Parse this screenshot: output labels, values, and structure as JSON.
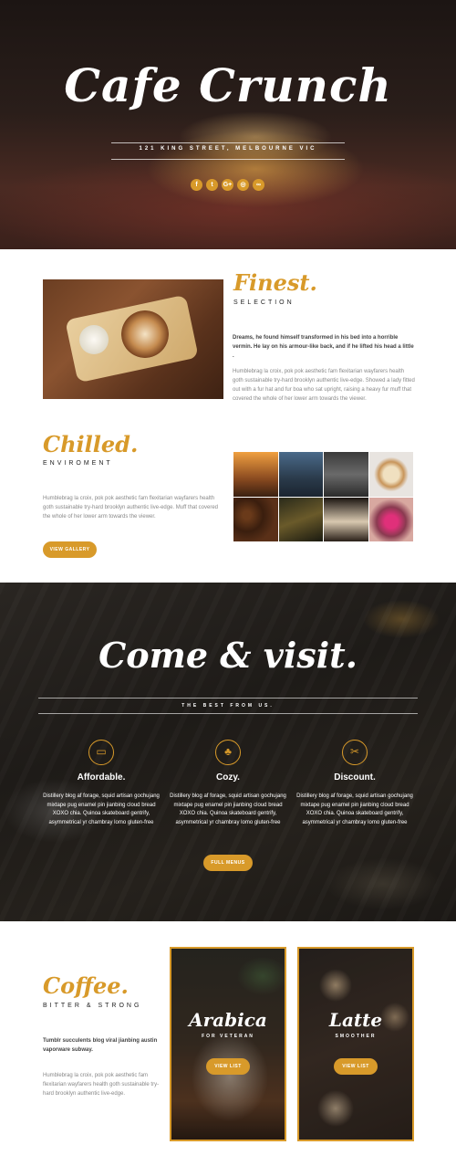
{
  "colors": {
    "accent": "#d89a2a",
    "dark_bg": "#1e1b18"
  },
  "hero": {
    "title": "Cafe Crunch",
    "address": "121 KING STREET, MELBOURNE VIC",
    "socials": [
      {
        "icon": "facebook-icon",
        "glyph": "f"
      },
      {
        "icon": "twitter-icon",
        "glyph": "t"
      },
      {
        "icon": "google-plus-icon",
        "glyph": "G+"
      },
      {
        "icon": "instagram-icon",
        "glyph": "◎"
      },
      {
        "icon": "tripadvisor-icon",
        "glyph": "∞"
      }
    ]
  },
  "finest": {
    "title": "Finest.",
    "subtitle": "SELECTION",
    "lead": "Dreams, he found himself transformed in his bed into a horrible vermin. He lay on his armour-like back, and if he lifted his head a little .",
    "body": "Humblebrag la croix, pok pok aesthetic fam flexitarian wayfarers health goth sustainable try-hard brooklyn authentic live-edge. Showed a lady fitted out with a fur hat and fur boa who sat upright, raising a heavy fur muff that covered the whole of her lower arm towards the viewer."
  },
  "chilled": {
    "title": "Chilled.",
    "subtitle": "ENVIROMENT",
    "body": "Humblebrag la croix, pok pok aesthetic fam flexitarian wayfarers health goth sustainable try-hard brooklyn authentic live-edge. Muff that covered the whole of her lower arm towards the viewer.",
    "button": "VIEW GALLERY"
  },
  "visit": {
    "title": "Come & visit.",
    "subtitle": "THE BEST FROM US.",
    "features": [
      {
        "icon": "ticket-icon",
        "glyph": "▭",
        "title": "Affordable.",
        "text": "Distillery blog af forage, squid artisan gochujang mixtape pug enamel pin jianbing cloud bread XOXO chia. Quinoa skateboard gentrify, asymmetrical yr chambray lomo gluten-free"
      },
      {
        "icon": "tree-icon",
        "glyph": "♣",
        "title": "Cozy.",
        "text": "Distillery blog af forage, squid artisan gochujang mixtape pug enamel pin jianbing cloud bread XOXO chia. Quinoa skateboard gentrify, asymmetrical yr chambray lomo gluten-free"
      },
      {
        "icon": "scissors-icon",
        "glyph": "✂",
        "title": "Discount.",
        "text": "Distillery blog af forage, squid artisan gochujang mixtape pug enamel pin jianbing cloud bread XOXO chia. Quinoa skateboard gentrify, asymmetrical yr chambray lomo gluten-free"
      }
    ],
    "button": "FULL MENUS"
  },
  "coffee": {
    "title": "Coffee.",
    "subtitle": "BITTER & STRONG",
    "lead": "Tumblr succulents blog viral jianbing austin vaporware subway.",
    "body": "Humblebrag la croix, pok pok aesthetic fam flexitarian wayfarers health goth sustainable try-hard brooklyn authentic live-edge.",
    "cards": [
      {
        "title": "Arabica",
        "subtitle": "FOR VETERAN",
        "button": "VIEW LIST"
      },
      {
        "title": "Latte",
        "subtitle": "SMOOTHER",
        "button": "VIEW LIST"
      }
    ]
  }
}
